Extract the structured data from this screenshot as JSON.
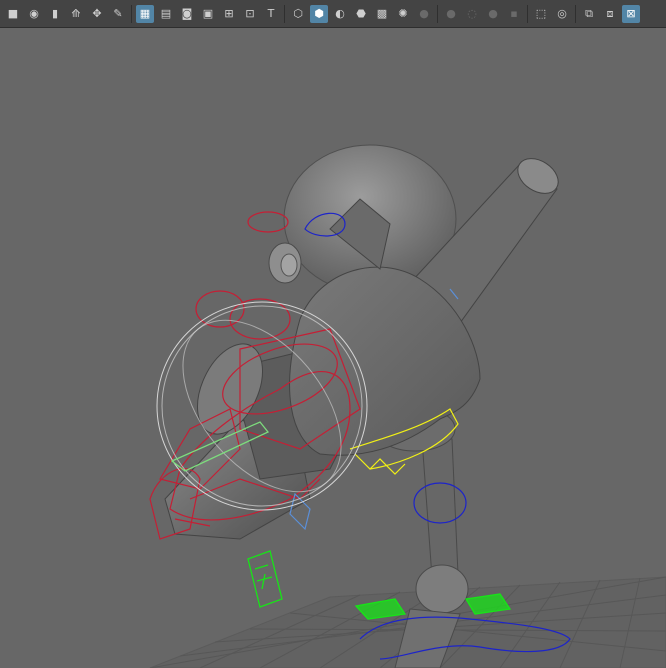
{
  "viewport_toolbar": {
    "buttons": [
      {
        "name": "camera-icon",
        "glyph": "■",
        "active": false,
        "dim": false
      },
      {
        "name": "camera-attributes-icon",
        "glyph": "◉",
        "active": false,
        "dim": false
      },
      {
        "name": "bookmark-icon",
        "glyph": "▮",
        "active": false,
        "dim": false
      },
      {
        "name": "image-plane-icon",
        "glyph": "⟰",
        "active": false,
        "dim": false
      },
      {
        "name": "pan-zoom-icon",
        "glyph": "✥",
        "active": false,
        "dim": false
      },
      {
        "name": "grease-pencil-icon",
        "glyph": "✎",
        "active": false,
        "dim": false
      },
      {
        "sep": true
      },
      {
        "name": "grid-icon",
        "glyph": "▦",
        "active": true,
        "dim": false
      },
      {
        "name": "film-gate-icon",
        "glyph": "▤",
        "active": false,
        "dim": false
      },
      {
        "name": "resolution-gate-icon",
        "glyph": "◙",
        "active": false,
        "dim": false
      },
      {
        "name": "gate-mask-icon",
        "glyph": "▣",
        "active": false,
        "dim": false
      },
      {
        "name": "field-chart-icon",
        "glyph": "⊞",
        "active": false,
        "dim": false
      },
      {
        "name": "safe-action-icon",
        "glyph": "⊡",
        "active": false,
        "dim": false
      },
      {
        "name": "safe-title-icon",
        "glyph": "T",
        "active": false,
        "dim": false
      },
      {
        "sep": true
      },
      {
        "name": "wireframe-icon",
        "glyph": "⬡",
        "active": false,
        "dim": false
      },
      {
        "name": "smooth-shade-icon",
        "glyph": "⬢",
        "active": true,
        "dim": false
      },
      {
        "name": "use-default-material-icon",
        "glyph": "◐",
        "active": false,
        "dim": false
      },
      {
        "name": "wireframe-on-shaded-icon",
        "glyph": "⬣",
        "active": false,
        "dim": false
      },
      {
        "name": "textured-icon",
        "glyph": "▩",
        "active": false,
        "dim": false
      },
      {
        "name": "use-all-lights-icon",
        "glyph": "✺",
        "active": false,
        "dim": false
      },
      {
        "name": "shadows-icon",
        "glyph": "●",
        "active": false,
        "dim": true
      },
      {
        "sep": true
      },
      {
        "name": "screen-space-ao-icon",
        "glyph": "●",
        "active": false,
        "dim": true
      },
      {
        "name": "motion-blur-icon",
        "glyph": "◌",
        "active": false,
        "dim": true
      },
      {
        "name": "multisample-aa-icon",
        "glyph": "●",
        "active": false,
        "dim": true
      },
      {
        "name": "depth-of-field-icon",
        "glyph": "▪",
        "active": false,
        "dim": true
      },
      {
        "sep": true
      },
      {
        "name": "isolate-select-icon",
        "glyph": "⬚",
        "active": false,
        "dim": false
      },
      {
        "name": "xray-icon",
        "glyph": "◎",
        "active": false,
        "dim": false
      },
      {
        "sep": true
      },
      {
        "name": "xray-active-components-icon",
        "glyph": "⧉",
        "active": false,
        "dim": false
      },
      {
        "name": "xray-joints-icon",
        "glyph": "⧈",
        "active": false,
        "dim": false
      },
      {
        "name": "backface-culling-icon",
        "glyph": "⊠",
        "active": true,
        "dim": false
      }
    ]
  },
  "scene": {
    "colors": {
      "background": "#676767",
      "grid": "#5f5f5f",
      "body_dark": "#5d5d5d",
      "body_mid": "#7a7a7a",
      "body_light": "#9c9c9c",
      "ctrl_red": "#c41f35",
      "ctrl_blue": "#1d24c9",
      "ctrl_yellow": "#f1f016",
      "ctrl_green": "#18e418",
      "ctrl_white": "#d6d6d6",
      "ctrl_light_blue": "#5b8fd8"
    }
  }
}
